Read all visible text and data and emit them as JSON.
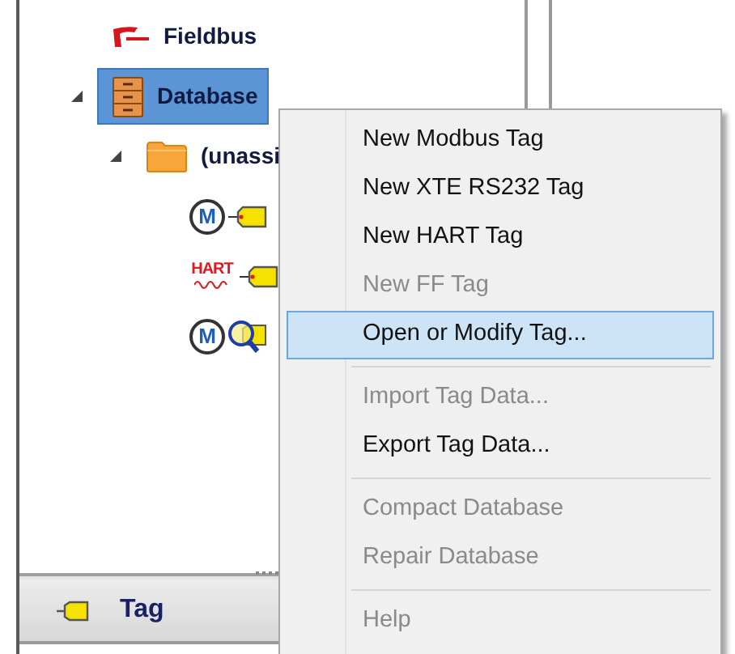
{
  "tree": [
    {
      "kind": "fieldbus",
      "label": "Fieldbus",
      "selected": false
    },
    {
      "kind": "database",
      "label": "Database",
      "selected": true,
      "expanded": true,
      "children": [
        {
          "kind": "folder",
          "label": "(unassi",
          "selected": false,
          "expanded": true,
          "children": [
            {
              "kind": "modbus-tag",
              "badge": "M",
              "selected": false
            },
            {
              "kind": "hart-tag",
              "badge": "HART",
              "selected": false
            },
            {
              "kind": "modbus-search",
              "badge": "M",
              "selected": false
            }
          ]
        }
      ]
    }
  ],
  "bottom_bar": {
    "label": "Tag"
  },
  "context_menu": [
    {
      "kind": "item",
      "label": "New Modbus Tag",
      "disabled": false,
      "selected": false
    },
    {
      "kind": "item",
      "label": "New XTE RS232 Tag",
      "disabled": false,
      "selected": false
    },
    {
      "kind": "item",
      "label": "New HART Tag",
      "disabled": false,
      "selected": false
    },
    {
      "kind": "item",
      "label": "New FF Tag",
      "disabled": true,
      "selected": false
    },
    {
      "kind": "item",
      "label": "Open or Modify Tag...",
      "disabled": false,
      "selected": true
    },
    {
      "kind": "separator"
    },
    {
      "kind": "item",
      "label": "Import Tag Data...",
      "disabled": true,
      "selected": false
    },
    {
      "kind": "item",
      "label": "Export Tag Data...",
      "disabled": false,
      "selected": false
    },
    {
      "kind": "separator"
    },
    {
      "kind": "item",
      "label": "Compact Database",
      "disabled": true,
      "selected": false
    },
    {
      "kind": "item",
      "label": "Repair Database",
      "disabled": true,
      "selected": false
    },
    {
      "kind": "separator"
    },
    {
      "kind": "item",
      "label": "Help",
      "disabled": true,
      "selected": false
    }
  ]
}
